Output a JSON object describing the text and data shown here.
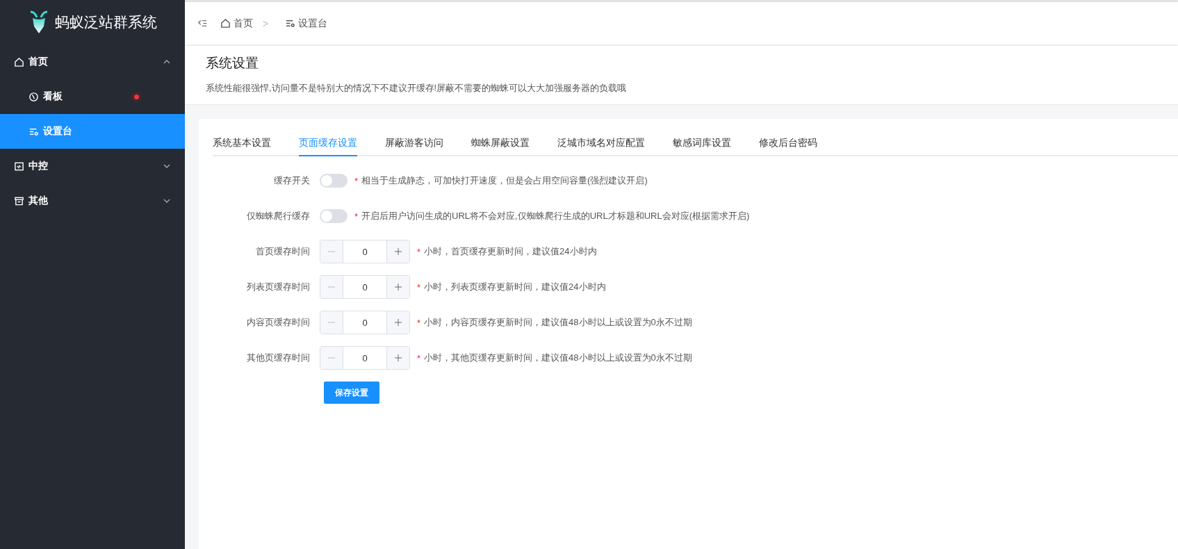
{
  "sidebar": {
    "logo_text": "蚂蚁泛站群系统",
    "menu": [
      {
        "label": "首页",
        "kind": "home",
        "expanded": true,
        "children": [
          {
            "label": "看板",
            "kind": "gauge",
            "selected": false,
            "dot": true
          },
          {
            "label": "设置台",
            "kind": "settings",
            "selected": true,
            "dot": false
          }
        ]
      },
      {
        "label": "中控",
        "kind": "code",
        "expanded": false
      },
      {
        "label": "其他",
        "kind": "archive",
        "expanded": false
      }
    ]
  },
  "breadcrumb": [
    {
      "label": "首页",
      "kind": "home"
    },
    {
      "label": "设置台",
      "kind": "settings"
    }
  ],
  "breadcrumb_separator": ">",
  "page_header": {
    "title": "系统设置",
    "description": "系统性能很强悍,访问量不是特别大的情况下不建议开缓存!屏蔽不需要的蜘蛛可以大大加强服务器的负载哦"
  },
  "tabs": [
    {
      "label": "系统基本设置",
      "selected": false
    },
    {
      "label": "页面缓存设置",
      "selected": true
    },
    {
      "label": "屏蔽游客访问",
      "selected": false
    },
    {
      "label": "蜘蛛屏蔽设置",
      "selected": false
    },
    {
      "label": "泛城市域名对应配置",
      "selected": false
    },
    {
      "label": "敏感词库设置",
      "selected": false
    },
    {
      "label": "修改后台密码",
      "selected": false
    }
  ],
  "form": [
    {
      "kind": "switch",
      "label": "缓存开关",
      "on": false,
      "mark": "*",
      "hint": "相当于生成静态，可加快打开速度，但是会占用空间容量(强烈建议开启)"
    },
    {
      "kind": "switch",
      "label": "仅蜘蛛爬行缓存",
      "on": false,
      "mark": "*",
      "hint": "开启后用户访问生成的URL将不会对应,仅蜘蛛爬行生成的URL才标题和URL会对应(根据需求开启)"
    },
    {
      "kind": "number",
      "label": "首页缓存时间",
      "value": "0",
      "mark": "*",
      "hint": "小时，首页缓存更新时间，建议值24小时内"
    },
    {
      "kind": "number",
      "label": "列表页缓存时间",
      "value": "0",
      "mark": "*",
      "hint": "小时，列表页缓存更新时间，建议值24小时内"
    },
    {
      "kind": "number",
      "label": "内容页缓存时间",
      "value": "0",
      "mark": "*",
      "hint": "小时，内容页缓存更新时间，建议值48小时以上或设置为0永不过期"
    },
    {
      "kind": "number",
      "label": "其他页缓存时间",
      "value": "0",
      "mark": "*",
      "hint": "小时，其他页缓存更新时间，建议值48小时以上或设置为0永不过期"
    }
  ],
  "save_button": "保存设置"
}
